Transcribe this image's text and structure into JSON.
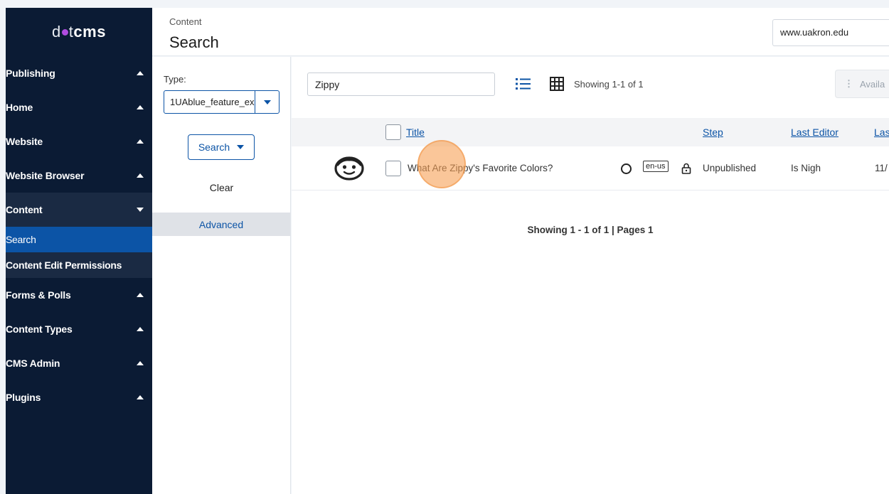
{
  "sidebar": {
    "logo": {
      "prefix": "d",
      "middle": "t",
      "bold": "cms"
    },
    "items": [
      {
        "label": "Publishing",
        "state": "collapsed"
      },
      {
        "label": "Home",
        "state": "collapsed"
      },
      {
        "label": "Website",
        "state": "collapsed"
      },
      {
        "label": "Website Browser",
        "state": "collapsed"
      },
      {
        "label": "Content",
        "state": "expanded"
      },
      {
        "label": "Forms & Polls",
        "state": "collapsed"
      },
      {
        "label": "Content Types",
        "state": "collapsed"
      },
      {
        "label": "CMS Admin",
        "state": "collapsed"
      },
      {
        "label": "Plugins",
        "state": "collapsed"
      }
    ],
    "content_sub": [
      {
        "label": "Search",
        "active": true
      },
      {
        "label": "Content Edit Permissions",
        "active": false
      }
    ]
  },
  "header": {
    "breadcrumb": "Content",
    "title": "Search",
    "site": "www.uakron.edu"
  },
  "filters": {
    "type_label": "Type:",
    "type_value": "1UAblue_feature_ex",
    "search_label": "Search",
    "clear_label": "Clear",
    "advanced_label": "Advanced"
  },
  "toolbar": {
    "query": "Zippy",
    "showing": "Showing 1-1 of 1",
    "available_label": "Availa"
  },
  "table": {
    "headers": {
      "title": "Title",
      "step": "Step",
      "last_editor": "Last Editor",
      "last_modified": "Las"
    },
    "rows": [
      {
        "title": "What Are Zippy's Favorite Colors?",
        "lang": "en-us",
        "step": "Unpublished",
        "last_editor": "Is Nigh",
        "last_modified": "11/"
      }
    ]
  },
  "pager": {
    "text": "Showing 1 - 1 of 1 | Pages 1"
  },
  "colors": {
    "sidebar_bg": "#0b1b34",
    "accent": "#0c54a6",
    "logo_dot": "#b04ce0",
    "click_marker": "#f7a055"
  }
}
